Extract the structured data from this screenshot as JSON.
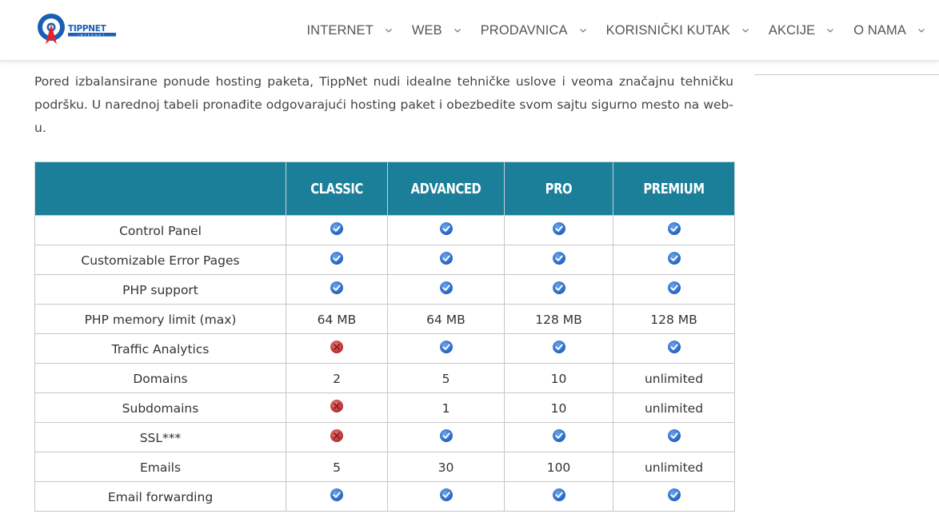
{
  "header": {
    "logo": {
      "brand": "TIPPNET",
      "tagline": "INTERNET"
    },
    "nav": [
      {
        "label": "INTERNET"
      },
      {
        "label": "WEB"
      },
      {
        "label": "PRODAVNICA"
      },
      {
        "label": "KORISNIČKI KUTAK"
      },
      {
        "label": "AKCIJE"
      },
      {
        "label": "O NAMA"
      }
    ]
  },
  "intro": {
    "text": "Pored izbalansirane ponude hosting paketa, TippNet nudi idealne tehničke uslove i veoma značajnu tehničku podršku. U narednoj tabeli pronađite odgovarajući hosting paket i obezbedite svom sajtu sigurno mesto na web-u."
  },
  "colors": {
    "table_header": "#1b7f9a",
    "check": "#2f74d0",
    "cross": "#c83a3a",
    "logo_blue": "#1a5fb4",
    "logo_red": "#e3242b"
  },
  "table": {
    "columns": [
      "",
      "CLASSIC",
      "ADVANCED",
      "PRO",
      "PREMIUM"
    ],
    "rows": [
      {
        "feature": "Control Panel",
        "values": [
          "check",
          "check",
          "check",
          "check"
        ]
      },
      {
        "feature": "Customizable Error Pages",
        "values": [
          "check",
          "check",
          "check",
          "check"
        ]
      },
      {
        "feature": "PHP support",
        "values": [
          "check",
          "check",
          "check",
          "check"
        ]
      },
      {
        "feature": "PHP memory limit (max)",
        "values": [
          "64 MB",
          "64 MB",
          "128 MB",
          "128 MB"
        ]
      },
      {
        "feature": "Traffic Analytics",
        "values": [
          "cross",
          "check",
          "check",
          "check"
        ]
      },
      {
        "feature": "Domains",
        "values": [
          "2",
          "5",
          "10",
          "unlimited"
        ]
      },
      {
        "feature": "Subdomains",
        "values": [
          "cross",
          "1",
          "10",
          "unlimited"
        ]
      },
      {
        "feature": "SSL***",
        "values": [
          "cross",
          "check",
          "check",
          "check"
        ]
      },
      {
        "feature": "Emails",
        "values": [
          "5",
          "30",
          "100",
          "unlimited"
        ]
      },
      {
        "feature": "Email forwarding",
        "values": [
          "check",
          "check",
          "check",
          "check"
        ]
      }
    ]
  }
}
